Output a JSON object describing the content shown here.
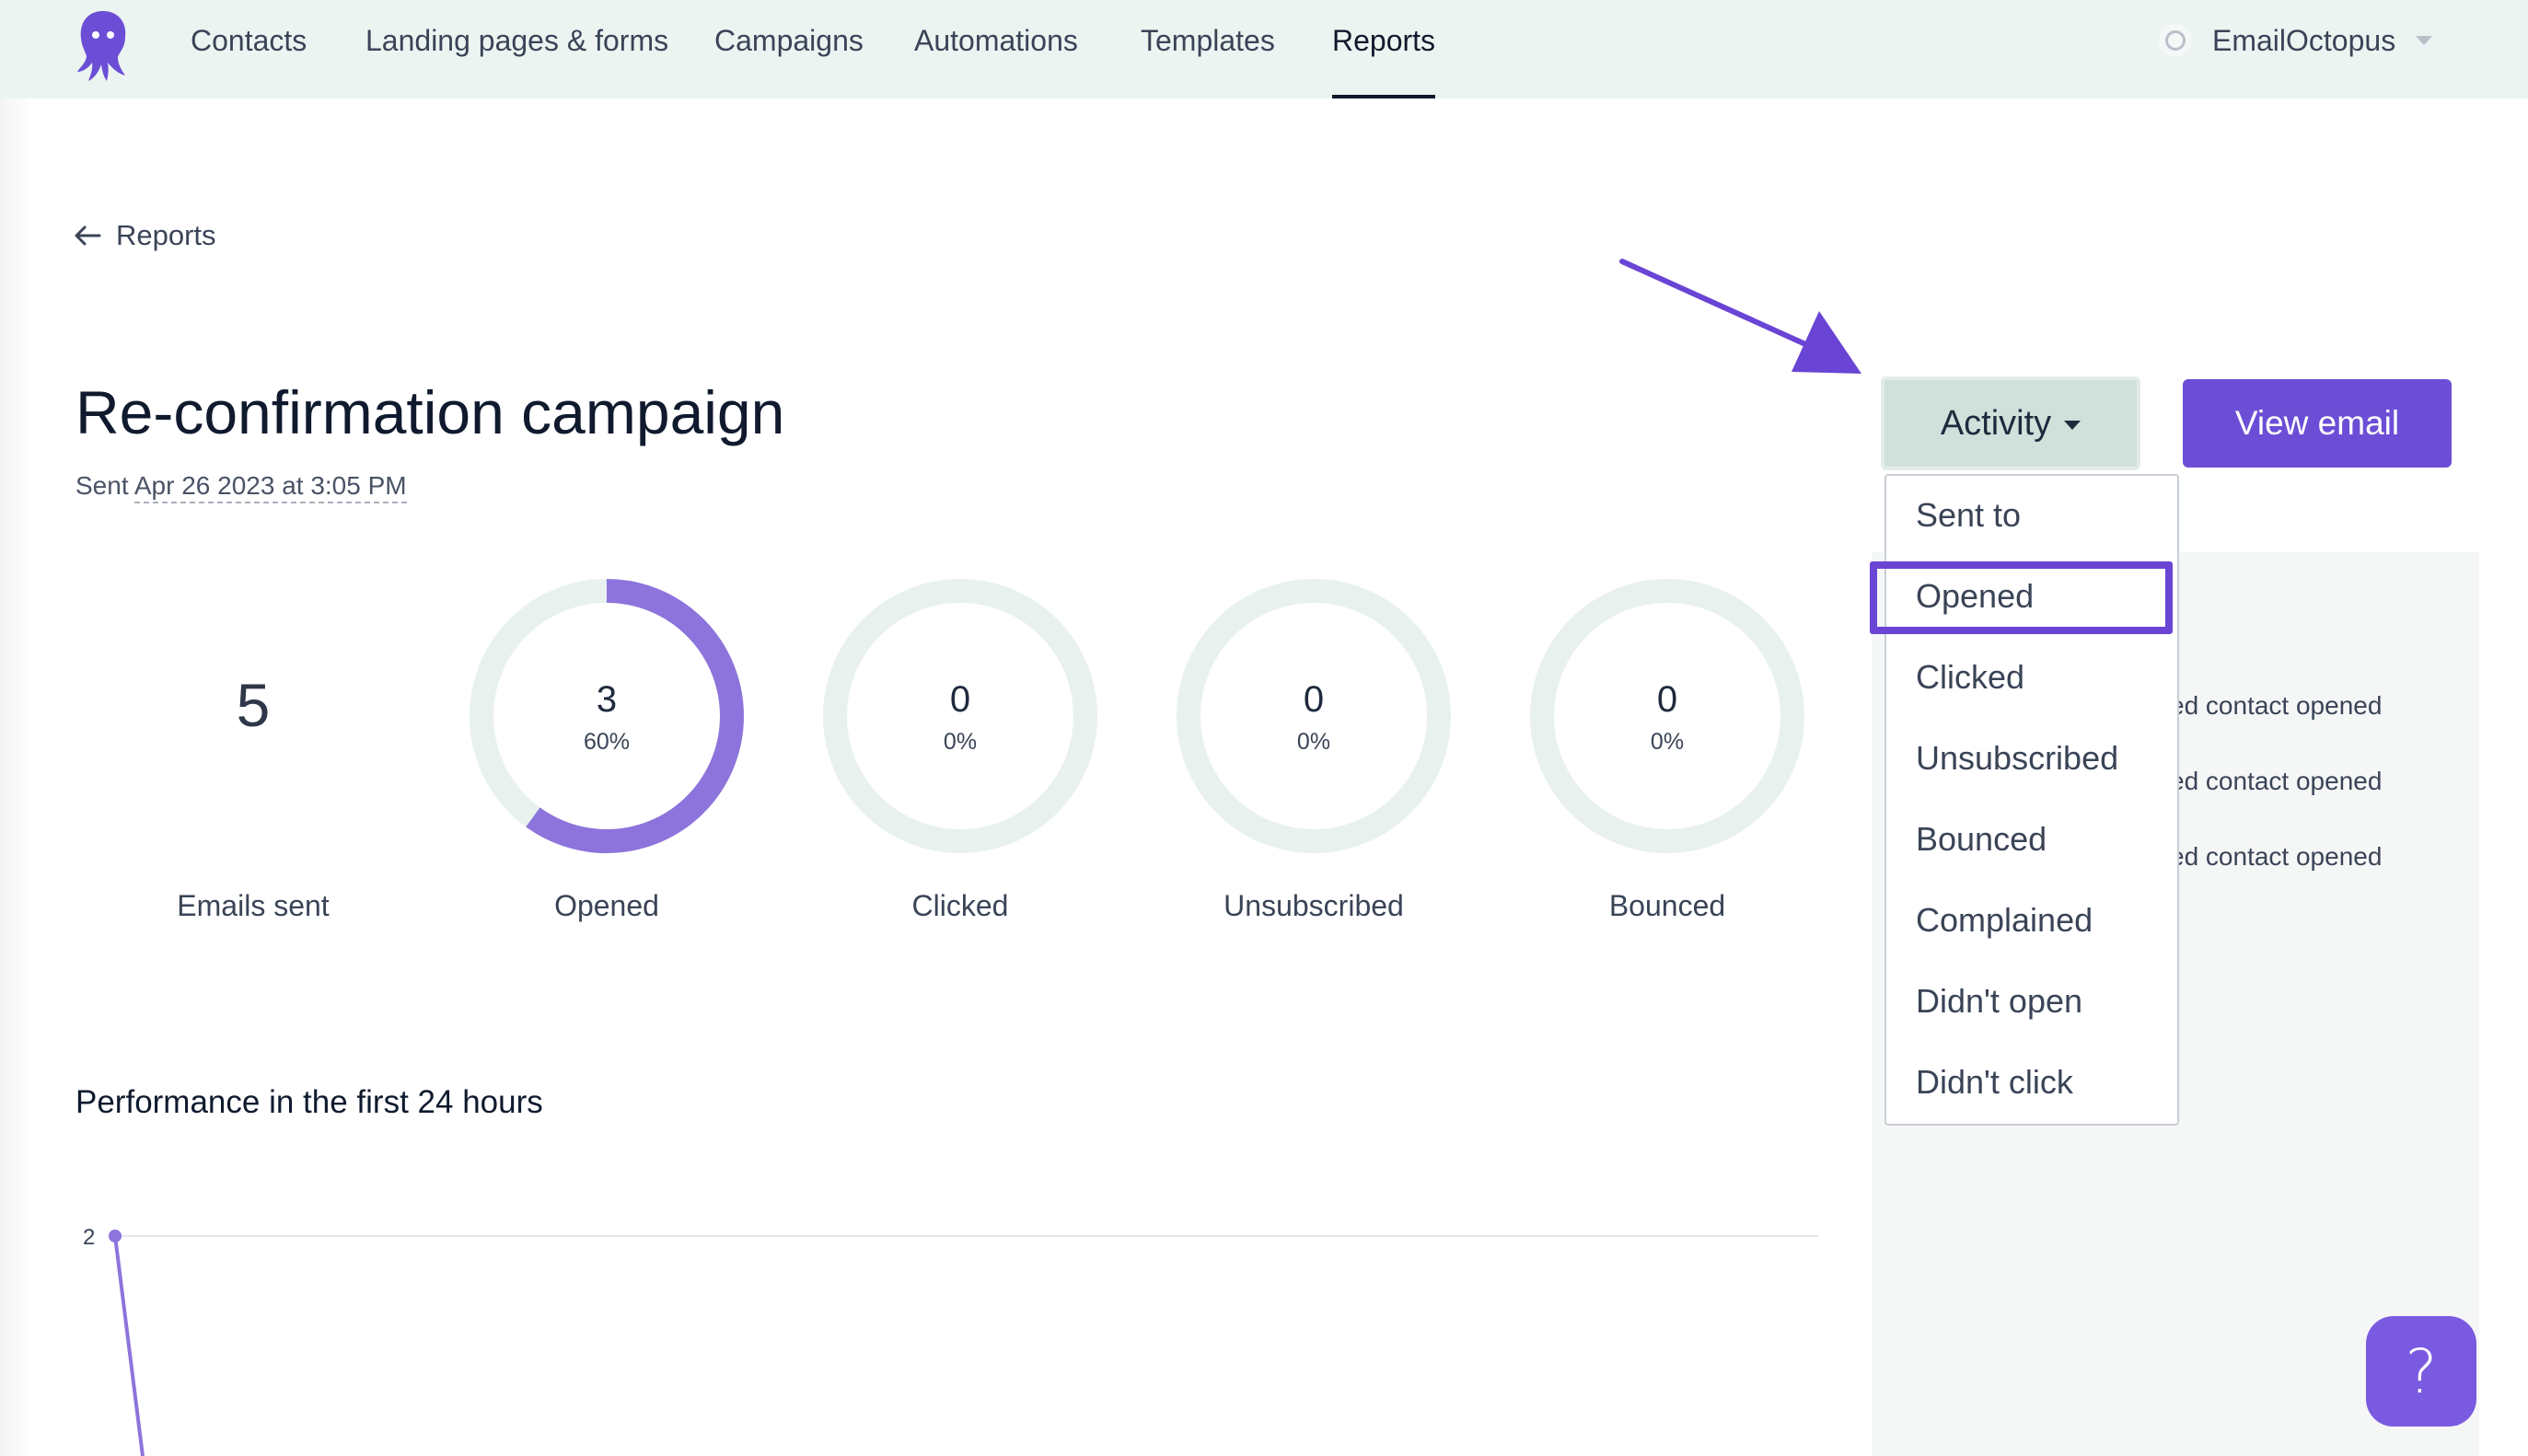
{
  "nav": {
    "items": [
      "Contacts",
      "Landing pages & forms",
      "Campaigns",
      "Automations",
      "Templates",
      "Reports"
    ],
    "active": "Reports",
    "account_name": "EmailOctopus"
  },
  "back_link": "Reports",
  "campaign": {
    "title": "Re-confirmation campaign",
    "sent_prefix": "Sent ",
    "sent_date": "Apr 26 2023 at 3:05 PM"
  },
  "stats": {
    "emails_sent": {
      "value": "5",
      "label": "Emails sent"
    },
    "opened": {
      "value": "3",
      "percent": "60%",
      "label": "Opened",
      "fraction": 0.6
    },
    "clicked": {
      "value": "0",
      "percent": "0%",
      "label": "Clicked",
      "fraction": 0
    },
    "unsubscribed": {
      "value": "0",
      "percent": "0%",
      "label": "Unsubscribed",
      "fraction": 0
    },
    "bounced": {
      "value": "0",
      "percent": "0%",
      "label": "Bounced",
      "fraction": 0
    }
  },
  "performance": {
    "title": "Performance in the first 24 hours",
    "y_tick": "2"
  },
  "buttons": {
    "activity": "Activity",
    "view_email": "View email"
  },
  "activity_menu": {
    "items": [
      "Sent to",
      "Opened",
      "Clicked",
      "Unsubscribed",
      "Bounced",
      "Complained",
      "Didn't open",
      "Didn't click"
    ],
    "highlighted": "Opened"
  },
  "activity_feed": [
    "ed contact opened",
    "ed contact opened",
    "ed contact opened"
  ],
  "help": {
    "glyph": "?"
  },
  "colors": {
    "brand": "#6c4ed6",
    "ring_track": "#e8f1ee",
    "ring_fill": "#8c74dc",
    "nav_bg": "#ecf4f1"
  }
}
